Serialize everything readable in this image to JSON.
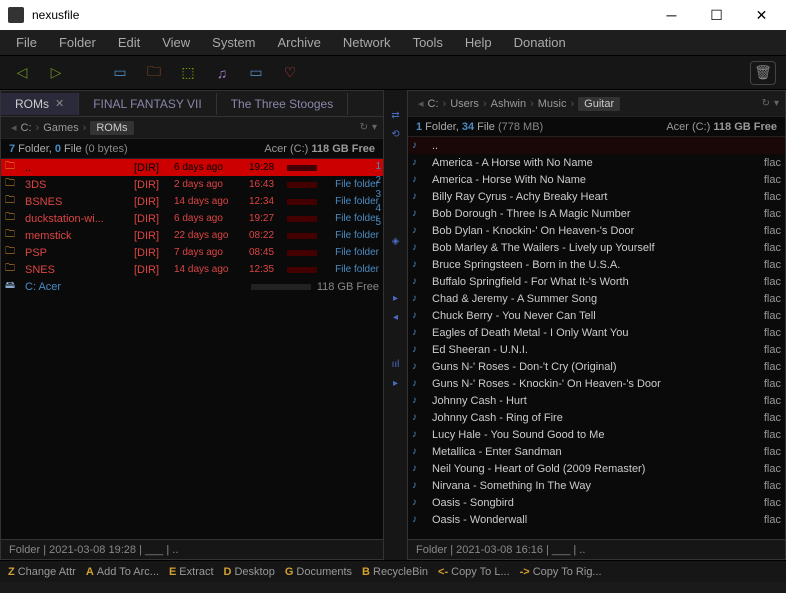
{
  "window": {
    "title": "nexusfile"
  },
  "menu": [
    "File",
    "Folder",
    "Edit",
    "View",
    "System",
    "Archive",
    "Network",
    "Tools",
    "Help",
    "Donation"
  ],
  "left": {
    "tabs": [
      {
        "label": "ROMs",
        "active": true,
        "closable": true
      },
      {
        "label": "FINAL FANTASY VII",
        "active": false
      },
      {
        "label": "The Three Stooges",
        "active": false
      }
    ],
    "crumbs": [
      "C:",
      "Games",
      "ROMs"
    ],
    "summary": {
      "folders": "7",
      "files": "0",
      "filesize": "(0 bytes)",
      "disk": "Acer (C:)",
      "free": "118 GB Free"
    },
    "items": [
      {
        "name": "..",
        "dir": "[DIR]",
        "date": "6 days ago",
        "time": "19:28",
        "type": "",
        "red": true
      },
      {
        "name": "3DS",
        "dir": "[DIR]",
        "date": "2 days ago",
        "time": "16:43",
        "type": "File folder"
      },
      {
        "name": "BSNES",
        "dir": "[DIR]",
        "date": "14 days ago",
        "time": "12:34",
        "type": "File folder"
      },
      {
        "name": "duckstation-wi...",
        "dir": "[DIR]",
        "date": "6 days ago",
        "time": "19:27",
        "type": "File folder"
      },
      {
        "name": "memstick",
        "dir": "[DIR]",
        "date": "22 days ago",
        "time": "08:22",
        "type": "File folder"
      },
      {
        "name": "PSP",
        "dir": "[DIR]",
        "date": "7 days ago",
        "time": "08:45",
        "type": "File folder"
      },
      {
        "name": "SNES",
        "dir": "[DIR]",
        "date": "14 days ago",
        "time": "12:35",
        "type": "File folder"
      }
    ],
    "drive": {
      "label": "C: Acer",
      "free": "118 GB Free"
    },
    "status": "Folder  |  2021-03-08 19:28  |  ___  |  .."
  },
  "right": {
    "crumbs": [
      "C:",
      "Users",
      "Ashwin",
      "Music",
      "Guitar"
    ],
    "summary": {
      "folders": "1",
      "files": "34",
      "filesize": "(778 MB)",
      "disk": "Acer (C:)",
      "free": "118 GB Free"
    },
    "items": [
      {
        "name": "..",
        "parent": true
      },
      {
        "name": "America - A Horse with No Name",
        "ext": "flac"
      },
      {
        "name": "America - Horse With No Name",
        "ext": "flac"
      },
      {
        "name": "Billy Ray Cyrus - Achy Breaky Heart",
        "ext": "flac"
      },
      {
        "name": "Bob Dorough - Three Is A Magic Number",
        "ext": "flac"
      },
      {
        "name": "Bob Dylan - Knockin-' On Heaven-'s Door",
        "ext": "flac"
      },
      {
        "name": "Bob Marley & The Wailers - Lively up Yourself",
        "ext": "flac"
      },
      {
        "name": "Bruce Springsteen - Born in the U.S.A.",
        "ext": "flac"
      },
      {
        "name": "Buffalo Springfield - For What It-'s Worth",
        "ext": "flac"
      },
      {
        "name": "Chad & Jeremy - A Summer Song",
        "ext": "flac"
      },
      {
        "name": "Chuck Berry - You Never Can Tell",
        "ext": "flac"
      },
      {
        "name": "Eagles of Death Metal - I Only Want You",
        "ext": "flac"
      },
      {
        "name": "Ed Sheeran - U.N.I.",
        "ext": "flac"
      },
      {
        "name": "Guns N-' Roses - Don-'t Cry (Original)",
        "ext": "flac"
      },
      {
        "name": "Guns N-' Roses - Knockin-' On Heaven-'s Door",
        "ext": "flac"
      },
      {
        "name": "Johnny Cash - Hurt",
        "ext": "flac"
      },
      {
        "name": "Johnny Cash - Ring of Fire",
        "ext": "flac"
      },
      {
        "name": "Lucy Hale - You Sound Good to Me",
        "ext": "flac"
      },
      {
        "name": "Metallica - Enter Sandman",
        "ext": "flac"
      },
      {
        "name": "Neil Young - Heart of Gold (2009 Remaster)",
        "ext": "flac"
      },
      {
        "name": "Nirvana - Something In The Way",
        "ext": "flac"
      },
      {
        "name": "Oasis - Songbird",
        "ext": "flac"
      },
      {
        "name": "Oasis - Wonderwall",
        "ext": "flac"
      }
    ],
    "status": "Folder  |  2021-03-08 16:16  |  ___  |  .."
  },
  "bottom": [
    {
      "key": "Z",
      "label": "Change Attr"
    },
    {
      "key": "A",
      "label": "Add To Arc..."
    },
    {
      "key": "E",
      "label": "Extract"
    },
    {
      "key": "D",
      "label": "Desktop"
    },
    {
      "key": "G",
      "label": "Documents"
    },
    {
      "key": "B",
      "label": "RecycleBin"
    },
    {
      "key": "<-",
      "label": "Copy To L..."
    },
    {
      "key": "->",
      "label": "Copy To Rig..."
    }
  ],
  "nums": [
    "1",
    "2",
    "3",
    "4",
    "5"
  ]
}
